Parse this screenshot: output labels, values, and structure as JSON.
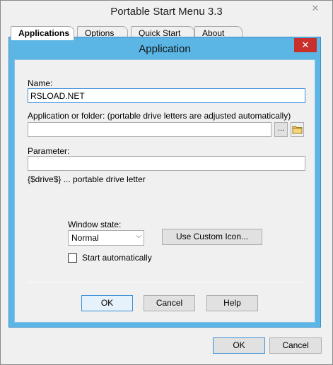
{
  "outer_window": {
    "title": "Portable Start Menu 3.3",
    "close_glyph": "✕",
    "tabs": [
      "Applications",
      "Options",
      "Quick Start",
      "About"
    ],
    "ok_label": "OK",
    "cancel_label": "Cancel"
  },
  "dialog": {
    "title": "Application",
    "close_glyph": "✕",
    "name_label": "Name:",
    "name_value": "RSLOAD.NET",
    "app_label": "Application or folder:  (portable drive letters are adjusted automatically)",
    "app_value": "",
    "browse_file_label": "...",
    "param_label": "Parameter:",
    "param_value": "",
    "drive_hint": "{$drive$} ... portable drive letter",
    "window_state_label": "Window state:",
    "window_state_value": "Normal",
    "custom_icon_label": "Use Custom Icon...",
    "start_auto_label": "Start automatically",
    "ok_label": "OK",
    "cancel_label": "Cancel",
    "help_label": "Help"
  },
  "colors": {
    "dialog_frame": "#5bb6e5",
    "close_red": "#c9302c",
    "focus_border": "#3c8fd8"
  },
  "icons": {
    "folder": "folder-icon",
    "dropdown": "chevron-down-icon"
  }
}
